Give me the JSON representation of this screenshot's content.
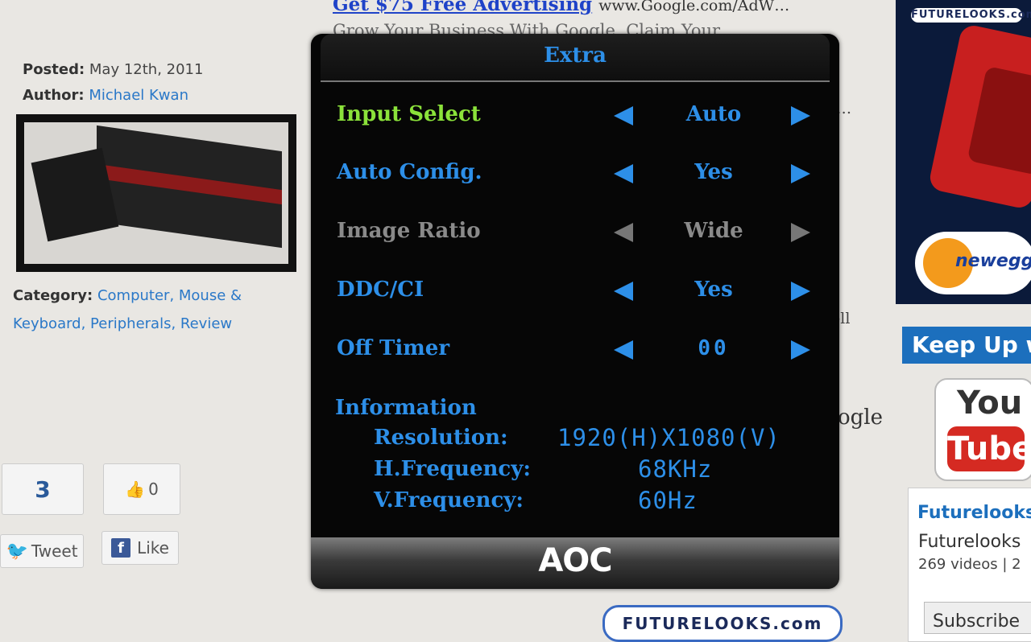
{
  "ad": {
    "title": "Get $75 Free Advertising",
    "url": "www.Google.com/AdW…",
    "line2": "Grow Your Business With Google. Claim Your"
  },
  "peeks": {
    "p1": "i…",
    "p2": "ell",
    "p3": "ogle"
  },
  "post": {
    "posted_label": "Posted:",
    "posted_value": "May 12th, 2011",
    "author_label": "Author:",
    "author_value": "Michael Kwan",
    "category_label": "Category:",
    "categories": "Computer, Mouse & Keyboard, Peripherals, Review"
  },
  "social": {
    "count": "3",
    "likes": "0",
    "tweet": "Tweet",
    "like": "Like"
  },
  "sidebar": {
    "logo": "FUTURELOOKS.com",
    "newegg": "newegg",
    "keep_up": "Keep Up w",
    "youtube_you": "You",
    "youtube_tube": "Tube",
    "channel_title": "Futurelooks",
    "channel_name": "Futurelooks",
    "channel_meta": "269 videos | 2",
    "subscribe": "Subscribe",
    "banner": "FUTURELOOKS.com"
  },
  "osd": {
    "title": "Extra",
    "rows": [
      {
        "label": "Input Select",
        "value": "Auto",
        "state": "active"
      },
      {
        "label": "Auto Config.",
        "value": "Yes",
        "state": "normal"
      },
      {
        "label": "Image Ratio",
        "value": "Wide",
        "state": "disabled"
      },
      {
        "label": "DDC/CI",
        "value": "Yes",
        "state": "normal"
      },
      {
        "label": "Off Timer",
        "value": "00",
        "state": "normal"
      }
    ],
    "info_heading": "Information",
    "resolution_label": "Resolution:",
    "resolution_value": "1920(H)X1080(V)",
    "hfreq_label": "H.Frequency:",
    "hfreq_value": "68KHz",
    "vfreq_label": "V.Frequency:",
    "vfreq_value": "60Hz",
    "brand": "AOC"
  },
  "colors": {
    "osd_blue": "#2d8fe8",
    "osd_active": "#8be23a",
    "osd_disabled": "#8a8a8a"
  }
}
